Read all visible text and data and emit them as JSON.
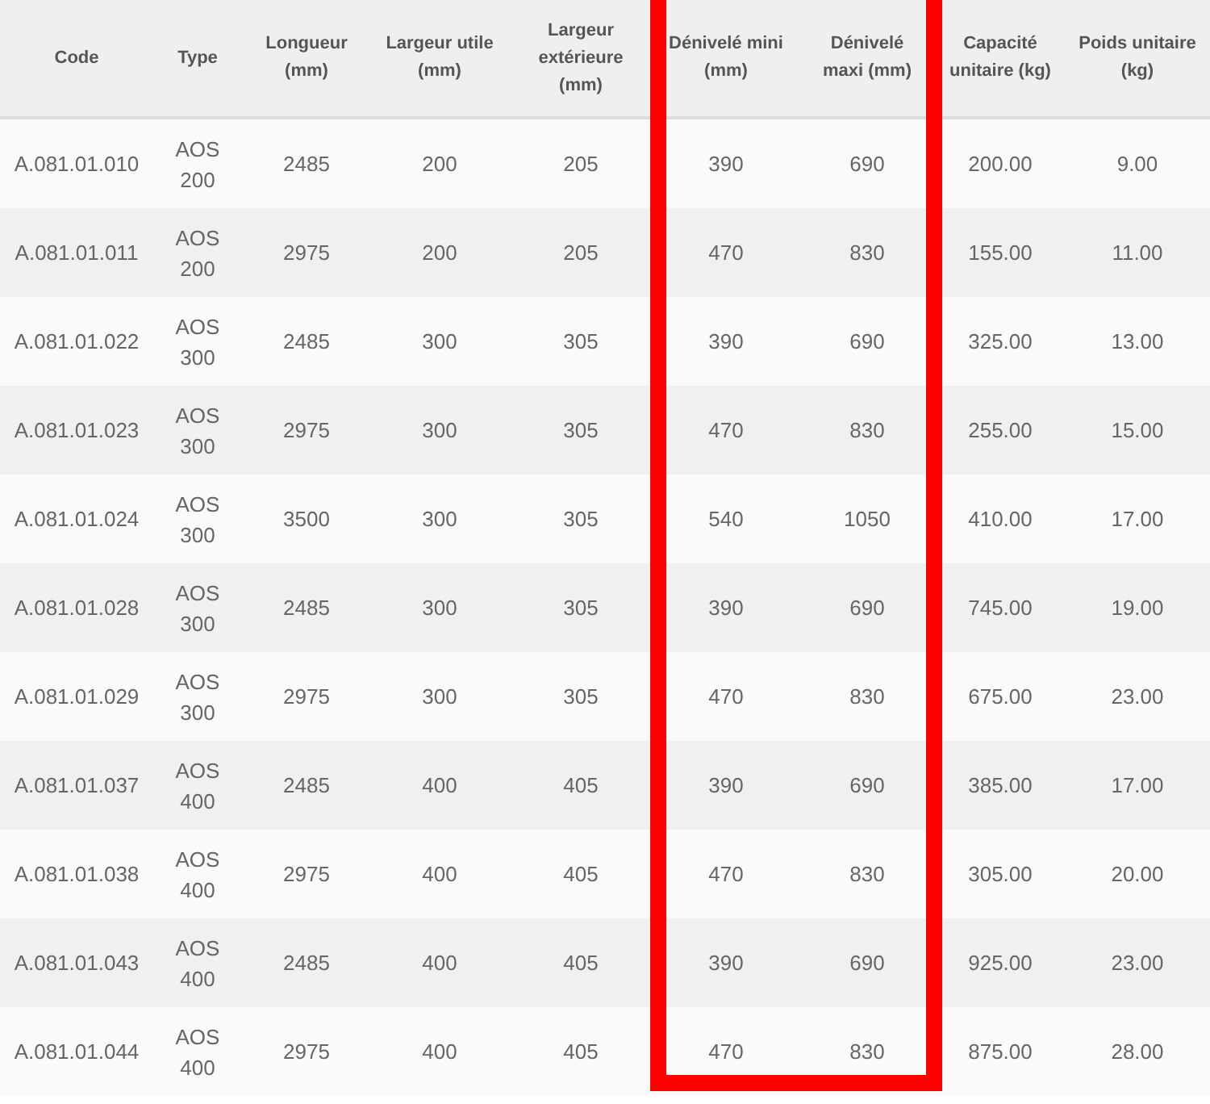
{
  "table": {
    "columns": [
      {
        "label": "Code",
        "highlighted": false
      },
      {
        "label": "Type",
        "highlighted": false
      },
      {
        "label": "Longueur (mm)",
        "highlighted": false
      },
      {
        "label": "Largeur utile (mm)",
        "highlighted": false
      },
      {
        "label": "Largeur extérieure (mm)",
        "highlighted": false
      },
      {
        "label": "Dénivelé mini (mm)",
        "highlighted": true
      },
      {
        "label": "Dénivelé maxi (mm)",
        "highlighted": true
      },
      {
        "label": "Capacité unitaire (kg)",
        "highlighted": false
      },
      {
        "label": "Poids unitaire (kg)",
        "highlighted": false
      }
    ],
    "rows": [
      [
        "A.081.01.010",
        "AOS 200",
        "2485",
        "200",
        "205",
        "390",
        "690",
        "200.00",
        "9.00"
      ],
      [
        "A.081.01.011",
        "AOS 200",
        "2975",
        "200",
        "205",
        "470",
        "830",
        "155.00",
        "11.00"
      ],
      [
        "A.081.01.022",
        "AOS 300",
        "2485",
        "300",
        "305",
        "390",
        "690",
        "325.00",
        "13.00"
      ],
      [
        "A.081.01.023",
        "AOS 300",
        "2975",
        "300",
        "305",
        "470",
        "830",
        "255.00",
        "15.00"
      ],
      [
        "A.081.01.024",
        "AOS 300",
        "3500",
        "300",
        "305",
        "540",
        "1050",
        "410.00",
        "17.00"
      ],
      [
        "A.081.01.028",
        "AOS 300",
        "2485",
        "300",
        "305",
        "390",
        "690",
        "745.00",
        "19.00"
      ],
      [
        "A.081.01.029",
        "AOS 300",
        "2975",
        "300",
        "305",
        "470",
        "830",
        "675.00",
        "23.00"
      ],
      [
        "A.081.01.037",
        "AOS 400",
        "2485",
        "400",
        "405",
        "390",
        "690",
        "385.00",
        "17.00"
      ],
      [
        "A.081.01.038",
        "AOS 400",
        "2975",
        "400",
        "405",
        "470",
        "830",
        "305.00",
        "20.00"
      ],
      [
        "A.081.01.043",
        "AOS 400",
        "2485",
        "400",
        "405",
        "390",
        "690",
        "925.00",
        "23.00"
      ],
      [
        "A.081.01.044",
        "AOS 400",
        "2975",
        "400",
        "405",
        "470",
        "830",
        "875.00",
        "28.00"
      ]
    ]
  }
}
